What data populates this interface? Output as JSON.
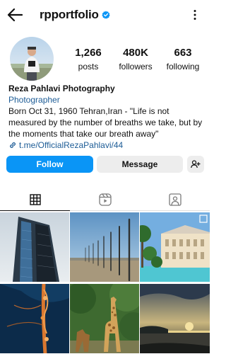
{
  "header": {
    "username": "rpportfolio",
    "back_icon": "arrow-left-icon",
    "verified_icon": "verified-badge-icon",
    "menu_icon": "more-vertical-icon"
  },
  "profile": {
    "avatar_icon": "profile-photo",
    "stats": [
      {
        "value": "1,266",
        "label": "posts"
      },
      {
        "value": "480K",
        "label": "followers"
      },
      {
        "value": "663",
        "label": "following"
      }
    ],
    "name": "Reza Pahlavi Photography",
    "category": "Photographer",
    "bio_line1": "Born Oct 31, 1960 Tehran,Iran - \"Life is not",
    "bio_line2": "measured by the number of breaths we take, but by",
    "bio_line3": "the moments that take our breath away\"",
    "link": "t.me/OfficialRezaPahlavi/44"
  },
  "actions": {
    "follow_label": "Follow",
    "message_label": "Message",
    "add_user_icon": "add-person-icon"
  },
  "tabs": [
    "grid-icon",
    "reels-icon",
    "tagged-icon"
  ],
  "grid": [
    "building-photo",
    "fence-posts-photo",
    "palace-pool-photo",
    "orange-plant-photo",
    "giraffe-photo",
    "sunset-sea-photo"
  ],
  "colors": {
    "accent": "#0a95f6",
    "link": "#1d5c96",
    "secondary_button": "#ededed"
  }
}
